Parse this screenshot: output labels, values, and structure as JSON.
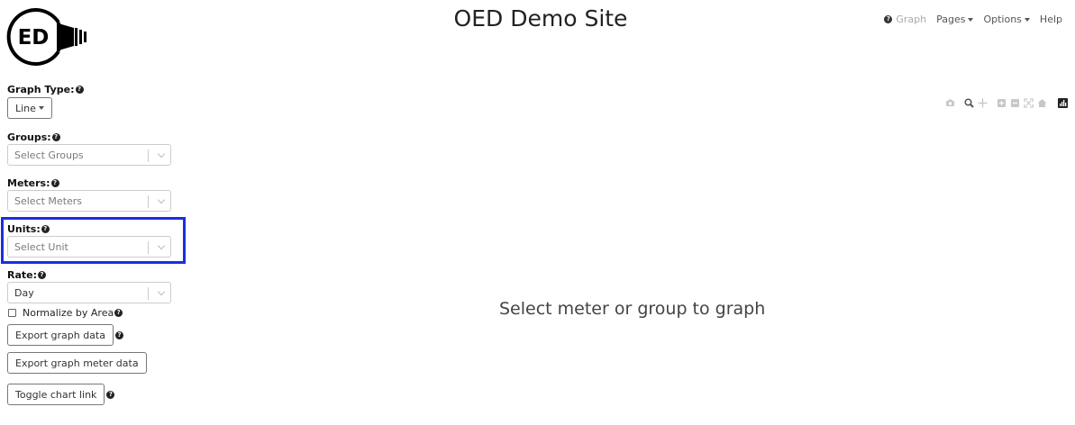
{
  "header": {
    "logo_text": "ED",
    "title": "OED Demo Site",
    "nav": {
      "graph": "Graph",
      "pages": "Pages",
      "options": "Options",
      "help": "Help"
    }
  },
  "sidebar": {
    "graph_type": {
      "label": "Graph Type:",
      "value": "Line"
    },
    "groups": {
      "label": "Groups:",
      "placeholder": "Select Groups"
    },
    "meters": {
      "label": "Meters:",
      "placeholder": "Select Meters"
    },
    "units": {
      "label": "Units:",
      "placeholder": "Select Unit"
    },
    "rate": {
      "label": "Rate:",
      "value": "Day"
    },
    "normalize": {
      "label": "Normalize by Area",
      "checked": false
    },
    "buttons": {
      "export_graph": "Export graph data",
      "export_meter": "Export graph meter data",
      "toggle_link": "Toggle chart link"
    }
  },
  "main": {
    "empty_message": "Select meter or group to graph"
  },
  "colors": {
    "highlight": "#1b2ee0",
    "text": "#212529"
  },
  "icons": {
    "help": "question-circle-icon",
    "modebar": [
      "camera-icon",
      "zoom-icon",
      "pan-icon",
      "zoom-in-icon",
      "zoom-out-icon",
      "autoscale-icon",
      "reset-axes-icon",
      "plotly-logo-icon"
    ]
  }
}
